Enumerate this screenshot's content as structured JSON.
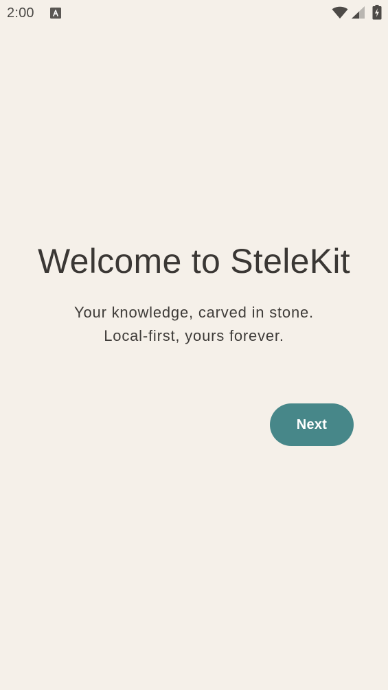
{
  "status_bar": {
    "time": "2:00",
    "notification_icon": "a-notification-icon",
    "wifi_icon": "wifi-icon",
    "signal_icon": "cell-signal-icon",
    "battery_icon": "battery-charging-icon"
  },
  "onboarding": {
    "title": "Welcome to SteleKit",
    "tagline_line1": "Your knowledge, carved in stone.",
    "tagline_line2": "Local-first, yours forever.",
    "next_label": "Next"
  },
  "colors": {
    "background": "#f5f0e9",
    "accent": "#478789",
    "text": "#3a3734"
  }
}
